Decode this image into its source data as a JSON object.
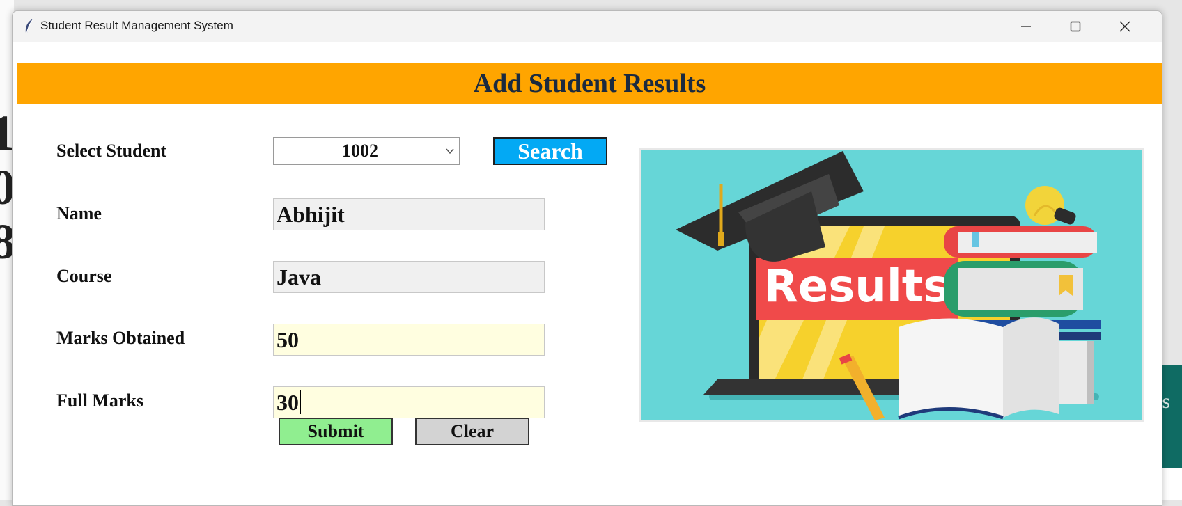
{
  "window": {
    "title": "Student Result Management System"
  },
  "header": {
    "title": "Add Student Results"
  },
  "form": {
    "select_student_label": "Select Student",
    "select_student_value": "1002",
    "search_button": "Search",
    "name_label": "Name",
    "name_value": "Abhijit",
    "course_label": "Course",
    "course_value": "Java",
    "marks_obtained_label": "Marks Obtained",
    "marks_obtained_value": "50",
    "full_marks_label": "Full Marks",
    "full_marks_value": "30",
    "submit_button": "Submit",
    "clear_button": "Clear"
  },
  "illustration": {
    "banner_text": "Results"
  },
  "colors": {
    "header_bg": "#ffa500",
    "search_bg": "#03a9f4",
    "submit_bg": "#90ee90",
    "clear_bg": "#d3d3d3",
    "editable_field_bg": "#fffee0",
    "readonly_field_bg": "#f0f0f0",
    "illustration_bg": "#66d6d7"
  },
  "icons": {
    "app": "feather-icon",
    "minimize": "minimize-icon",
    "maximize": "maximize-icon",
    "close": "close-icon",
    "dropdown": "chevron-down-icon"
  }
}
